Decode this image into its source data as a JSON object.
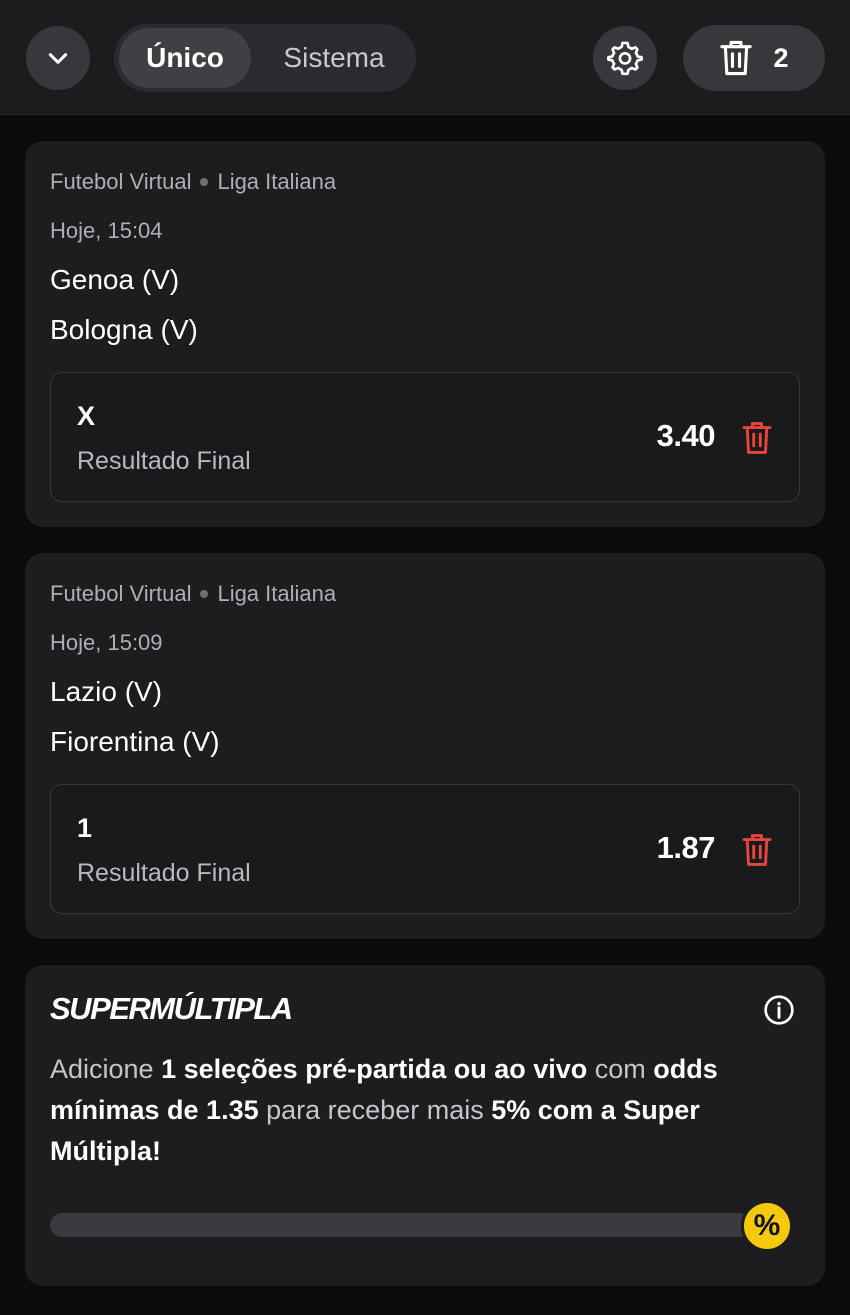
{
  "header": {
    "tabs": [
      {
        "label": "Único",
        "active": true
      },
      {
        "label": "Sistema",
        "active": false
      }
    ],
    "selection_count": "2",
    "icons": {
      "collapse": "chevron-down-icon",
      "settings": "gear-icon",
      "clear_all": "trash-icon"
    }
  },
  "bets": [
    {
      "league": "Futebol Virtual",
      "competition": "Liga Italiana",
      "date": "Hoje, 15:04",
      "home": "Genoa (V)",
      "away": "Bologna (V)",
      "pick": "X",
      "market": "Resultado Final",
      "odds": "3.40"
    },
    {
      "league": "Futebol Virtual",
      "competition": "Liga Italiana",
      "date": "Hoje, 15:09",
      "home": "Lazio (V)",
      "away": "Fiorentina (V)",
      "pick": "1",
      "market": "Resultado Final",
      "odds": "1.87"
    }
  ],
  "supermultipla": {
    "title": "SUPERMÚLTIPLA",
    "text_1": "Adicione ",
    "text_2": "1 seleções pré-partida ou ao vivo",
    "text_3": " com ",
    "text_4": "odds mínimas de 1.35",
    "text_5": " para receber mais ",
    "text_6": "5% com a Super Múltipla!",
    "progress_percent": 0,
    "badge": "%"
  },
  "colors": {
    "background": "#0b0b0c",
    "card": "#1d1d20",
    "delete_red": "#e8453c",
    "badge_yellow": "#f7c90b"
  }
}
